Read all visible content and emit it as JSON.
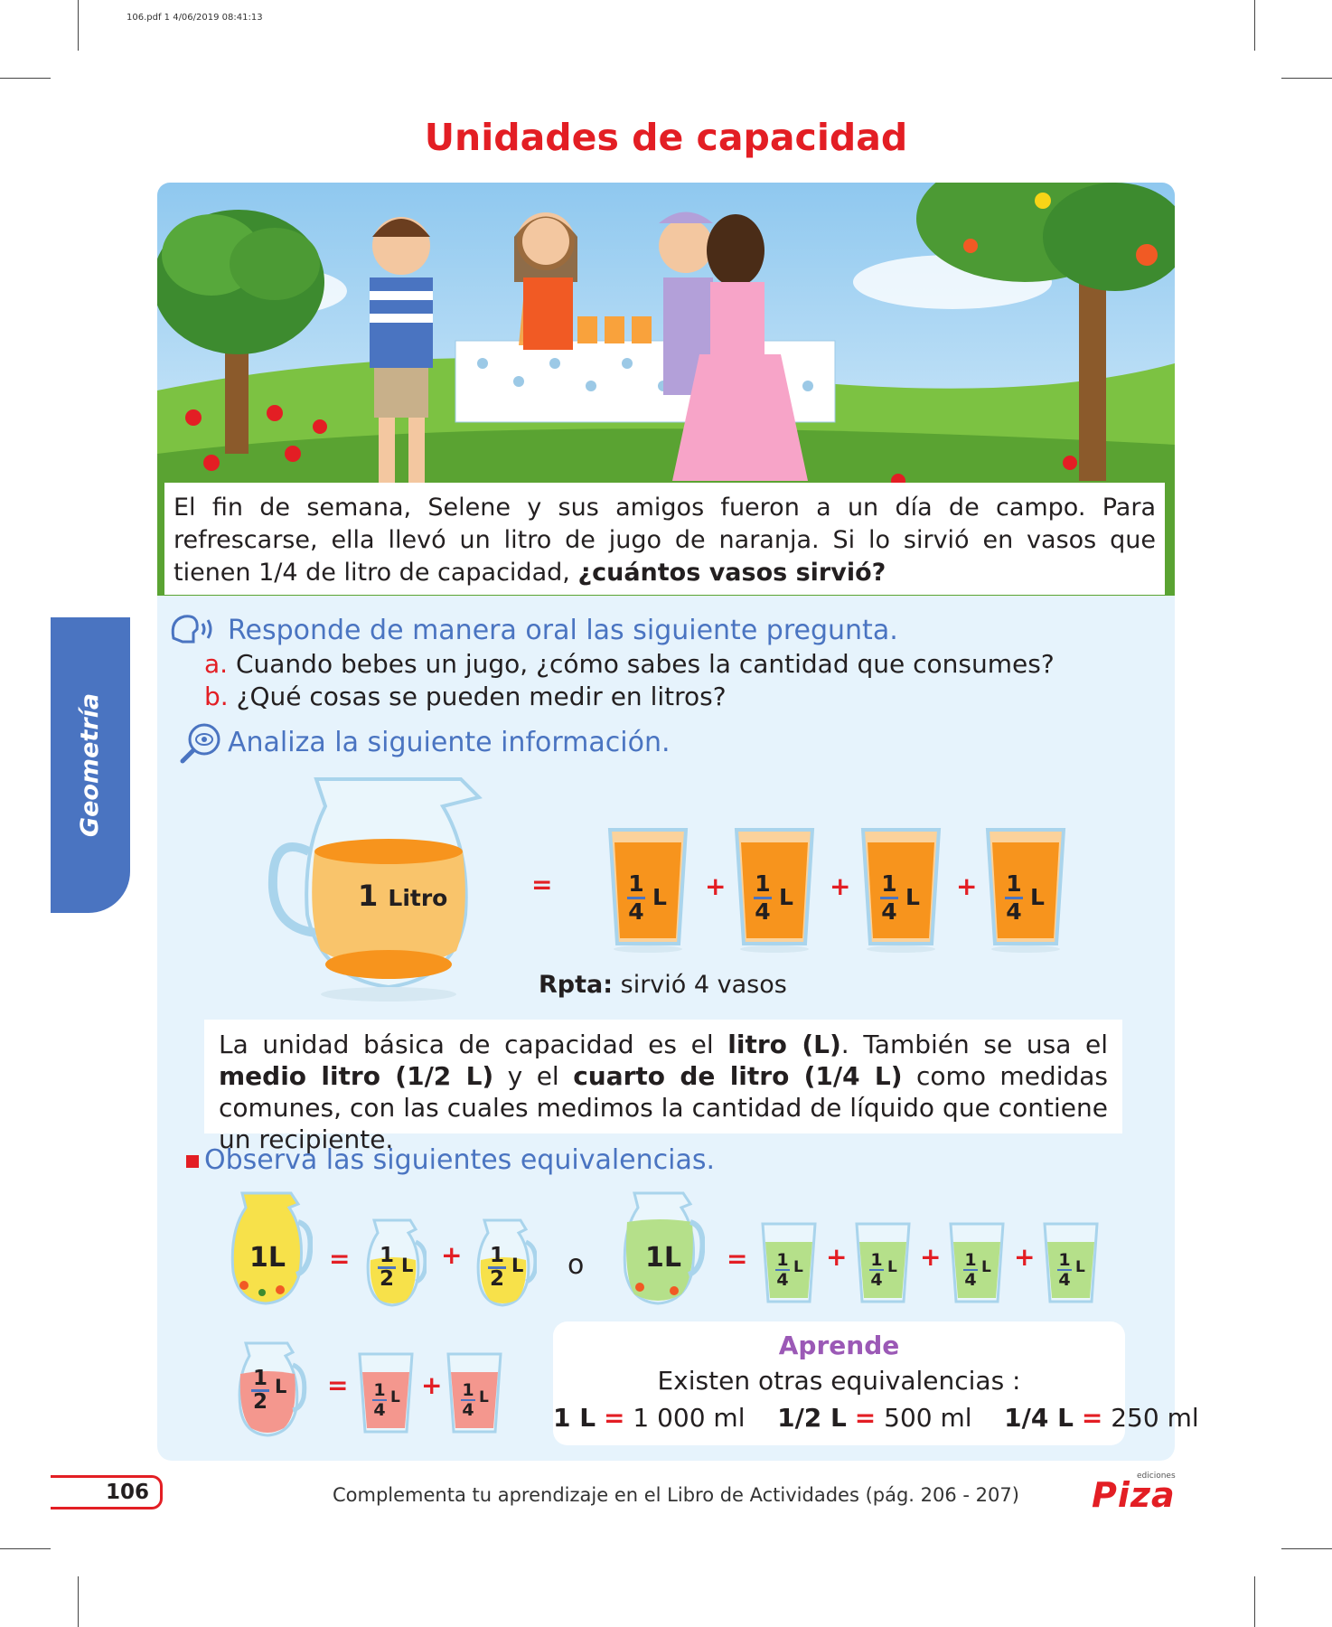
{
  "file_info": "106.pdf   1   4/06/2019   08:41:13",
  "title": "Unidades de capacidad",
  "story": {
    "text": "El fin de semana, Selene y sus amigos fueron a un día de campo. Para refrescarse, ella llevó un litro de jugo de naranja. Si lo sirvió en vasos que tienen 1/4 de litro de capacidad, ",
    "question": "¿cuántos vasos sirvió?"
  },
  "side_tab": "Geometría",
  "oral": {
    "heading": "Responde de manera oral las siguiente pregunta.",
    "items": [
      {
        "letter": "a.",
        "text": "Cuando bebes un jugo, ¿cómo sabes la cantidad que consumes?"
      },
      {
        "letter": "b.",
        "text": "¿Qué cosas se pueden medir en litros?"
      }
    ]
  },
  "analyze": {
    "heading": "Analiza la siguiente información.",
    "jug_label_num": "1",
    "jug_label_unit": "Litro",
    "equals": "=",
    "plus": "+",
    "glass_num": "1",
    "glass_den": "4",
    "glass_unit": "L",
    "answer_label": "Rpta:",
    "answer_text": " sirvió 4 vasos"
  },
  "info": {
    "p1": "La unidad básica de capacidad es el ",
    "b1": "litro (L)",
    "p2": ". También se usa el ",
    "b2": "medio litro (1/2 L)",
    "p3": " y el ",
    "b3": "cuarto de litro (1/4 L)",
    "p4": " como medidas comunes, con las cuales medimos la cantidad de líquido que contiene un recipiente."
  },
  "equivalences": {
    "heading": "Observa las siguientes equivalencias.",
    "one_liter": "1L",
    "half_num": "1",
    "half_den": "2",
    "quarter_num": "1",
    "quarter_den": "4",
    "unit": "L",
    "or": "o",
    "equals": "=",
    "plus": "+"
  },
  "learn": {
    "title": "Aprende",
    "subtitle": "Existen otras equivalencias :",
    "eq1_left": "1 L",
    "eq1_right": "1 000 ml",
    "eq2_left": "1/2 L",
    "eq2_right": "500 ml",
    "eq3_left": "1/4 L",
    "eq3_right": "250 ml",
    "eq_sign": "="
  },
  "footer": {
    "page": "106",
    "text": "Complementa tu aprendizaje en el Libro de Actividades (pág. 206 - 207)",
    "logo": "Piza",
    "logo_small": "ediciones"
  },
  "colors": {
    "accent_red": "#e31e24",
    "accent_blue": "#4a74c1",
    "panel_bg": "#e6f3fc",
    "orange_juice": "#f7941d",
    "green_juice": "#b5e08a",
    "pink_juice": "#f4978e"
  }
}
